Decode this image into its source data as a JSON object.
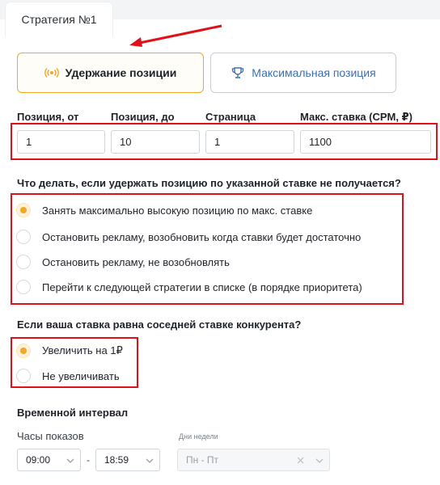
{
  "strategy_tab": {
    "label": "Стратегия №1"
  },
  "modes": {
    "hold": {
      "label": "Удержание позиции",
      "icon": "broadcast-icon"
    },
    "max": {
      "label": "Максимальная позиция",
      "icon": "trophy-icon"
    }
  },
  "fields": [
    {
      "label": "Позиция, от",
      "value": "1"
    },
    {
      "label": "Позиция, до",
      "value": "10"
    },
    {
      "label": "Страница",
      "value": "1"
    },
    {
      "label": "Макс. ставка (CPM, ₽)",
      "value": "1100"
    }
  ],
  "question1": {
    "title": "Что делать, если удержать позицию по указанной ставке не получается?",
    "options": [
      "Занять максимально высокую позицию по макс. ставке",
      "Остановить рекламу, возобновить когда ставки будет достаточно",
      "Остановить рекламу, не возобновлять",
      "Перейти к следующей стратегии в списке (в порядке приоритета)"
    ],
    "selected": 0
  },
  "question2": {
    "title": "Если ваша ставка равна соседней ставке конкурента?",
    "options": [
      "Увеличить на 1₽",
      "Не увеличивать"
    ],
    "selected": 0
  },
  "interval": {
    "title": "Временной интервал",
    "hours_label": "Часы показов",
    "from": "09:00",
    "separator": "-",
    "to": "18:59",
    "days_label": "Дни недели",
    "days_value": "Пн - Пт"
  },
  "colors": {
    "accent": "#f5a623",
    "highlight": "#e0101b",
    "link": "#3b6fb6"
  }
}
